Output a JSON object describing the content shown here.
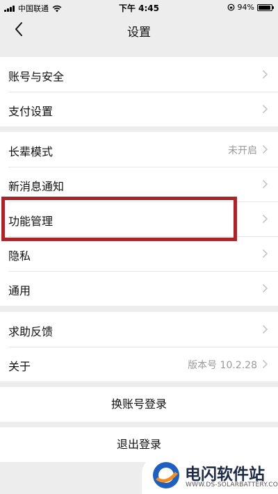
{
  "status_bar": {
    "carrier": "中国联通",
    "time": "下午 4:45",
    "battery_percent": "94%",
    "battery_level": 0.94
  },
  "header": {
    "title": "设置",
    "back_icon": "chevron-left-icon"
  },
  "groups": [
    {
      "items": [
        {
          "label": "账号与安全",
          "value": ""
        },
        {
          "label": "支付设置",
          "value": ""
        }
      ]
    },
    {
      "items": [
        {
          "label": "长辈模式",
          "value": "未开启"
        },
        {
          "label": "新消息通知",
          "value": ""
        },
        {
          "label": "功能管理",
          "value": "",
          "highlighted": true
        },
        {
          "label": "隐私",
          "value": ""
        },
        {
          "label": "通用",
          "value": ""
        }
      ]
    },
    {
      "items": [
        {
          "label": "求助反馈",
          "value": ""
        },
        {
          "label": "关于",
          "value": "版本号 10.2.28"
        }
      ]
    }
  ],
  "actions": {
    "switch_account": "换账号登录",
    "logout": "退出登录"
  },
  "watermark": {
    "name": "电闪软件站",
    "domain": "WWW.DS-SOLARBATTERY.COM"
  },
  "colors": {
    "background": "#ededed",
    "card": "#ffffff",
    "highlight": "#a8262a",
    "secondary_text": "#9a9a9a"
  }
}
